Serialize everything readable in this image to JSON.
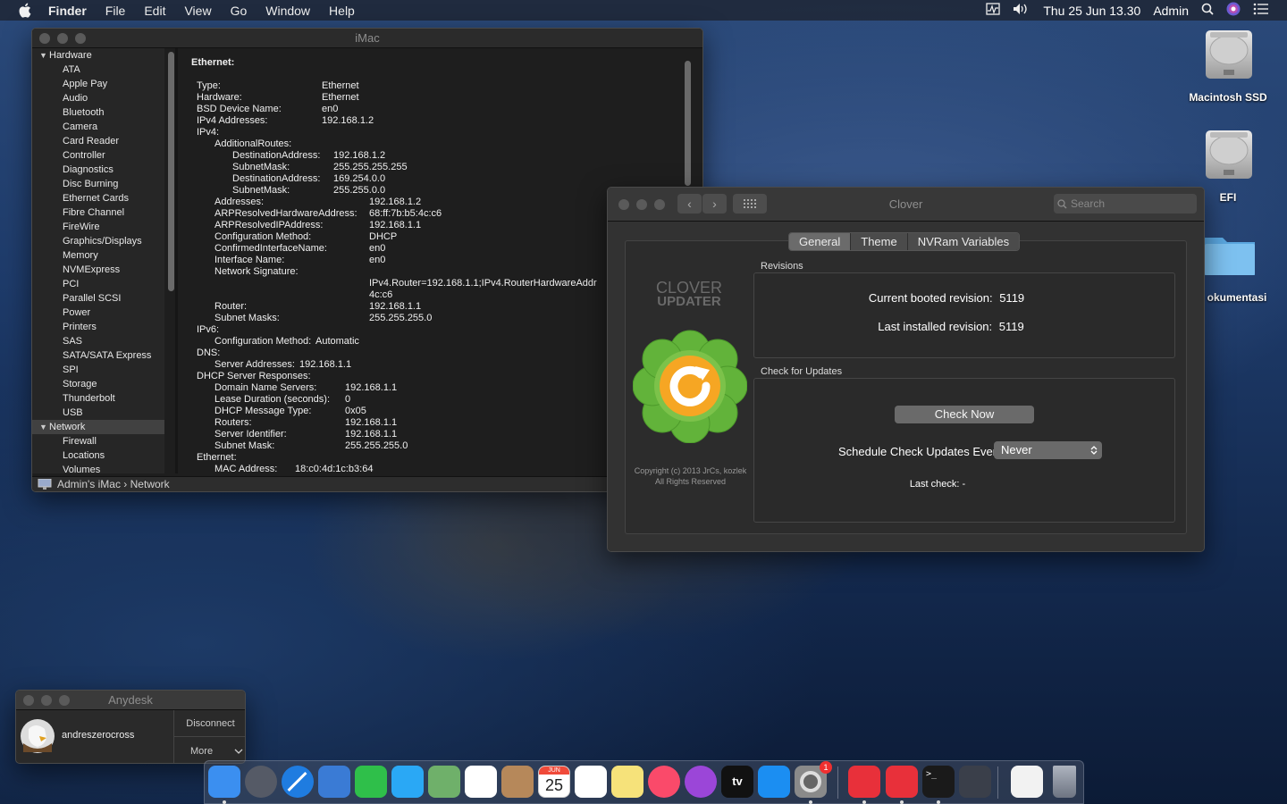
{
  "menubar": {
    "app": "Finder",
    "items": [
      "File",
      "Edit",
      "View",
      "Go",
      "Window",
      "Help"
    ],
    "clock": "Thu 25 Jun  13.30",
    "user": "Admin"
  },
  "desktop": {
    "icons": [
      {
        "label": "Macintosh SSD",
        "icon": "hard-drive-icon"
      },
      {
        "label": "EFI",
        "icon": "hard-drive-icon"
      },
      {
        "label": "okumentasi",
        "icon": "folder-icon"
      }
    ]
  },
  "sysinfo": {
    "title": "iMac",
    "sidebar": [
      {
        "label": "Hardware",
        "head": true
      },
      {
        "label": "ATA"
      },
      {
        "label": "Apple Pay"
      },
      {
        "label": "Audio"
      },
      {
        "label": "Bluetooth"
      },
      {
        "label": "Camera"
      },
      {
        "label": "Card Reader"
      },
      {
        "label": "Controller"
      },
      {
        "label": "Diagnostics"
      },
      {
        "label": "Disc Burning"
      },
      {
        "label": "Ethernet Cards"
      },
      {
        "label": "Fibre Channel"
      },
      {
        "label": "FireWire"
      },
      {
        "label": "Graphics/Displays"
      },
      {
        "label": "Memory"
      },
      {
        "label": "NVMExpress"
      },
      {
        "label": "PCI"
      },
      {
        "label": "Parallel SCSI"
      },
      {
        "label": "Power"
      },
      {
        "label": "Printers"
      },
      {
        "label": "SAS"
      },
      {
        "label": "SATA/SATA Express"
      },
      {
        "label": "SPI"
      },
      {
        "label": "Storage"
      },
      {
        "label": "Thunderbolt"
      },
      {
        "label": "USB"
      },
      {
        "label": "Network",
        "head": true,
        "selected": true
      },
      {
        "label": "Firewall"
      },
      {
        "label": "Locations"
      },
      {
        "label": "Volumes"
      }
    ],
    "heading": "Ethernet:",
    "lines": [
      {
        "k": "Type:",
        "v": "Ethernet",
        "i": 0
      },
      {
        "k": "Hardware:",
        "v": "Ethernet",
        "i": 0
      },
      {
        "k": "BSD Device Name:",
        "v": "en0",
        "i": 0
      },
      {
        "k": "IPv4 Addresses:",
        "v": "192.168.1.2",
        "i": 0
      },
      {
        "k": "IPv4:",
        "v": "",
        "i": 0
      },
      {
        "k": "AdditionalRoutes:",
        "v": "",
        "i": 1
      },
      {
        "k": "DestinationAddress:",
        "v": "192.168.1.2",
        "i": 2
      },
      {
        "k": "SubnetMask:",
        "v": "255.255.255.255",
        "i": 2
      },
      {
        "k": "DestinationAddress:",
        "v": "169.254.0.0",
        "i": 2
      },
      {
        "k": "SubnetMask:",
        "v": "255.255.0.0",
        "i": 2
      },
      {
        "k": "Addresses:",
        "v": "192.168.1.2",
        "i": 1
      },
      {
        "k": "ARPResolvedHardwareAddress:",
        "v": "68:ff:7b:b5:4c:c6",
        "i": 1
      },
      {
        "k": "ARPResolvedIPAddress:",
        "v": "192.168.1.1",
        "i": 1
      },
      {
        "k": "Configuration Method:",
        "v": "DHCP",
        "i": 1
      },
      {
        "k": "ConfirmedInterfaceName:",
        "v": "en0",
        "i": 1
      },
      {
        "k": "Interface Name:",
        "v": "en0",
        "i": 1
      },
      {
        "k": "Network Signature:",
        "v": "",
        "i": 1
      },
      {
        "k": "",
        "v": "IPv4.Router=192.168.1.1;IPv4.RouterHardwareAddr",
        "i": 1
      },
      {
        "k": "",
        "v": "4c:c6",
        "i": 1
      },
      {
        "k": "Router:",
        "v": "192.168.1.1",
        "i": 1
      },
      {
        "k": "Subnet Masks:",
        "v": "255.255.255.0",
        "i": 1
      },
      {
        "k": "IPv6:",
        "v": "",
        "i": 0
      },
      {
        "k": "Configuration Method:",
        "v": "Automatic",
        "i": 1,
        "inline": true
      },
      {
        "k": "DNS:",
        "v": "",
        "i": 0
      },
      {
        "k": "Server Addresses:",
        "v": "192.168.1.1",
        "i": 1,
        "inline": true
      },
      {
        "k": "DHCP Server Responses:",
        "v": "",
        "i": 0
      },
      {
        "k": "Domain Name Servers:",
        "v": "192.168.1.1",
        "i": 1,
        "c": "dhcp"
      },
      {
        "k": "Lease Duration (seconds):",
        "v": "0",
        "i": 1,
        "c": "dhcp"
      },
      {
        "k": "DHCP Message Type:",
        "v": "0x05",
        "i": 1,
        "c": "dhcp"
      },
      {
        "k": "Routers:",
        "v": "192.168.1.1",
        "i": 1,
        "c": "dhcp"
      },
      {
        "k": "Server Identifier:",
        "v": "192.168.1.1",
        "i": 1,
        "c": "dhcp"
      },
      {
        "k": "Subnet Mask:",
        "v": "255.255.255.0",
        "i": 1,
        "c": "dhcp"
      },
      {
        "k": "Ethernet:",
        "v": "",
        "i": 0
      },
      {
        "k": "MAC Address:",
        "v": "18:c0:4d:1c:b3:64",
        "i": 1,
        "c": "mac"
      }
    ],
    "breadcrumb": "Admin's iMac › Network"
  },
  "clover": {
    "title": "Clover",
    "search_placeholder": "Search",
    "tabs": [
      {
        "label": "General",
        "active": true
      },
      {
        "label": "Theme"
      },
      {
        "label": "NVRam Variables"
      }
    ],
    "logo_line1": "CLOVER",
    "logo_line2": "UPDATER",
    "copyright1": "Copyright (c) 2013 JrCs, kozlek",
    "copyright2": "All Rights Reserved",
    "revisions_label": "Revisions",
    "current_booted": "Current booted revision:",
    "current_booted_value": "5119",
    "last_installed": "Last installed revision:",
    "last_installed_value": "5119",
    "updates_label": "Check for Updates",
    "check_now": "Check Now",
    "schedule_label": "Schedule Check Updates Every:",
    "schedule_value": "Never",
    "last_check": "Last check: -"
  },
  "anydesk": {
    "title": "Anydesk",
    "user": "andreszerocross",
    "disconnect": "Disconnect",
    "more": "More"
  },
  "dock": {
    "calendar_month": "JUN",
    "calendar_day": "25",
    "badge": "1",
    "apps": [
      "finder-icon",
      "launchpad-icon",
      "safari-icon",
      "mail-icon",
      "facetime-icon",
      "messages-icon",
      "maps-icon",
      "photos-icon",
      "contacts-icon",
      "calendar-icon",
      "reminders-icon",
      "notes-icon",
      "music-icon",
      "podcasts-icon",
      "tv-icon",
      "app-store-icon",
      "system-preferences-icon",
      "anydesk-icon",
      "anydesk-session-icon",
      "terminal-icon",
      "usb-icon",
      "document-icon",
      "trash-icon"
    ],
    "tv_label": "tv"
  }
}
